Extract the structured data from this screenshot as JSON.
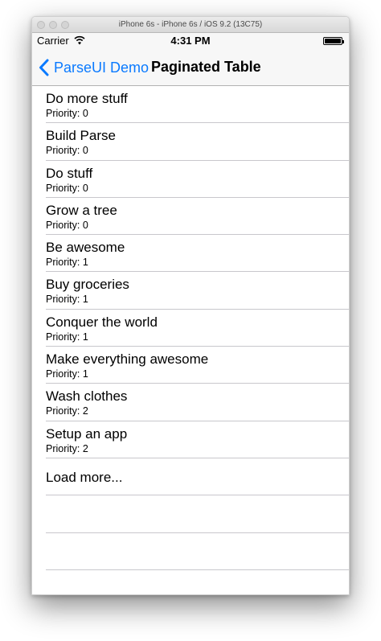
{
  "window": {
    "title": "iPhone 6s - iPhone 6s / iOS 9.2 (13C75)"
  },
  "status_bar": {
    "carrier": "Carrier",
    "time": "4:31 PM"
  },
  "navbar": {
    "back_label": "ParseUI Demo",
    "title": "Paginated Table"
  },
  "rows": [
    {
      "title": "Do more stuff",
      "subtitle": "Priority: 0"
    },
    {
      "title": "Build Parse",
      "subtitle": "Priority: 0"
    },
    {
      "title": "Do stuff",
      "subtitle": "Priority: 0"
    },
    {
      "title": "Grow a tree",
      "subtitle": "Priority: 0"
    },
    {
      "title": "Be awesome",
      "subtitle": "Priority: 1"
    },
    {
      "title": "Buy groceries",
      "subtitle": "Priority: 1"
    },
    {
      "title": "Conquer the world",
      "subtitle": "Priority: 1"
    },
    {
      "title": "Make everything awesome",
      "subtitle": "Priority: 1"
    },
    {
      "title": "Wash clothes",
      "subtitle": "Priority: 2"
    },
    {
      "title": "Setup an app",
      "subtitle": "Priority: 2"
    }
  ],
  "load_more_label": "Load more...",
  "colors": {
    "accent": "#0a7aff",
    "separator": "#c8c7cc",
    "bar_background": "#f7f7f7"
  }
}
